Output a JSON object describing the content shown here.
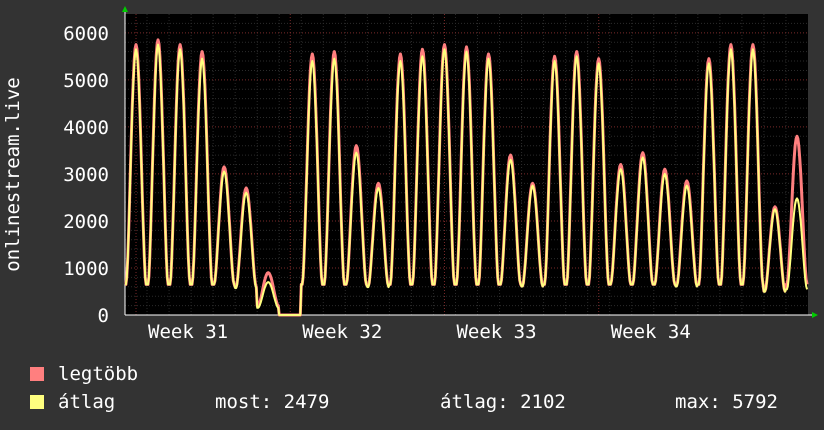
{
  "chart_data": {
    "type": "area",
    "ylabel": "onlinestream.live",
    "ylim": [
      0,
      6400
    ],
    "yticks": [
      0,
      1000,
      2000,
      3000,
      4000,
      5000,
      6000
    ],
    "x_range_days": [
      0,
      31
    ],
    "xtick_labels": [
      {
        "label": "Week 31",
        "day": 0.5
      },
      {
        "label": "Week 32",
        "day": 7.5
      },
      {
        "label": "Week 33",
        "day": 14.5
      },
      {
        "label": "Week 34",
        "day": 21.5
      }
    ],
    "grid": true,
    "series": [
      {
        "name": "legtöbb",
        "color": "#ff7f7f",
        "daily_peaks": [
          5750,
          5850,
          5750,
          5600,
          3150,
          2700,
          900,
          0,
          5550,
          5600,
          3600,
          2800,
          5550,
          5650,
          5750,
          5700,
          5550,
          3400,
          2800,
          5500,
          5600,
          5450,
          3200,
          3450,
          3100,
          2850,
          5450,
          5750,
          5750,
          2300,
          3800
        ]
      },
      {
        "name": "átlag",
        "color": "#ffff7f",
        "daily_peaks": [
          5650,
          5750,
          5650,
          5450,
          3050,
          2600,
          700,
          0,
          5400,
          5450,
          3450,
          2700,
          5400,
          5500,
          5650,
          5600,
          5450,
          3300,
          2750,
          5400,
          5500,
          5350,
          3100,
          3350,
          3000,
          2750,
          5350,
          5650,
          5650,
          2250,
          2479
        ]
      }
    ]
  },
  "legend": {
    "max_label": "legtöbb",
    "avg_label": "átlag",
    "stats": {
      "now": "most: 2479",
      "avg": "átlag: 2102",
      "max": "max: 5792"
    }
  }
}
